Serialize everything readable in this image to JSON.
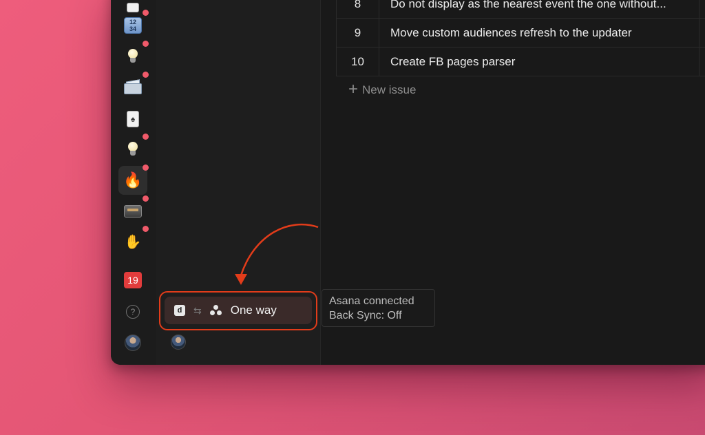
{
  "issues": [
    {
      "num": "8",
      "title": "Do not display as the nearest event the one without..."
    },
    {
      "num": "9",
      "title": "Move custom audiences refresh to the updater"
    },
    {
      "num": "10",
      "title": "Create FB pages parser"
    }
  ],
  "new_issue_label": "New issue",
  "rail": {
    "numbers_tile": [
      "12",
      "34"
    ],
    "calendar_day": "19",
    "help_glyph": "?"
  },
  "sync": {
    "badge": "d",
    "arrows": "⇆",
    "mode_label": "One way"
  },
  "tooltip": {
    "line1": "Asana connected",
    "line2": "Back Sync: Off"
  },
  "colors": {
    "accent_annotation": "#e23c1a",
    "notification_dot": "#f05a6a",
    "calendar": "#e23c3c"
  }
}
